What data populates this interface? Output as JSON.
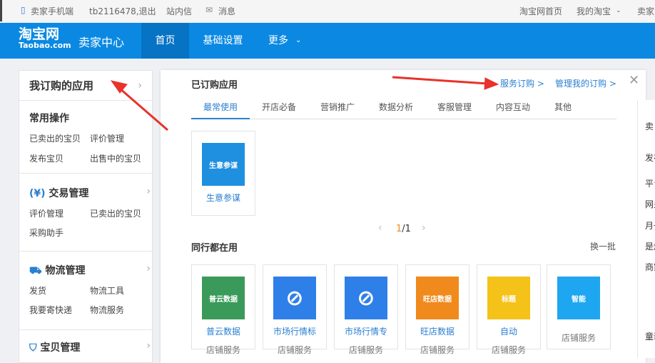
{
  "topbar": {
    "mobile": "卖家手机端",
    "user": "tb2116478,退出",
    "inbox": "站内信",
    "messages": "消息",
    "home": "淘宝网首页",
    "my_taobao": "我的淘宝",
    "seller": "卖家中"
  },
  "header": {
    "logo": "淘宝网",
    "logo_sub": "Taobao.com",
    "title": "卖家中心",
    "nav": [
      "首页",
      "基础设置",
      "更多"
    ]
  },
  "sidebar": {
    "head": "我订购的应用",
    "sections": [
      {
        "title": "常用操作",
        "links": [
          "已卖出的宝贝",
          "评价管理",
          "发布宝贝",
          "出售中的宝贝"
        ]
      },
      {
        "title": "交易管理",
        "links": [
          "评价管理",
          "已卖出的宝贝",
          "采购助手"
        ]
      },
      {
        "title": "物流管理",
        "links": [
          "发货",
          "物流工具",
          "我要寄快递",
          "物流服务"
        ]
      },
      {
        "title": "宝贝管理",
        "links": []
      }
    ]
  },
  "panel": {
    "title": "已订购应用",
    "service_link": "服务订购 >",
    "manage_link": "管理我的订购 >",
    "tabs": [
      "最常使用",
      "开店必备",
      "营销推广",
      "数据分析",
      "客服管理",
      "内容互动",
      "其他"
    ],
    "subscribed": [
      {
        "name": "生意参谋",
        "icon_text": "生意参谋",
        "color": "#1f8fe0"
      }
    ],
    "pager": {
      "current": "1",
      "total": "/1"
    },
    "peers_title": "同行都在用",
    "refresh": "换一批",
    "peers": [
      {
        "name": "普云数据",
        "type": "店铺服务",
        "icon_text": "普云数据",
        "color": "#3a9a5a"
      },
      {
        "name": "市场行情标",
        "type": "店铺服务",
        "icon_text": "",
        "color": "#2f7fe8"
      },
      {
        "name": "市场行情专",
        "type": "店铺服务",
        "icon_text": "",
        "color": "#2f7fe8"
      },
      {
        "name": "旺店数据",
        "type": "店铺服务",
        "icon_text": "旺店数据",
        "color": "#f08a1c"
      },
      {
        "name": "自动",
        "type": "店铺服务",
        "icon_text": "标题",
        "color": "#f5c21a"
      },
      {
        "name": "",
        "type": "店铺服务",
        "icon_text": "智能",
        "color": "#1ea7f0"
      }
    ]
  },
  "right": {
    "items": [
      "卖",
      "发布",
      "平台",
      "网关",
      "月一",
      "是炫",
      "商家",
      "童装"
    ]
  }
}
